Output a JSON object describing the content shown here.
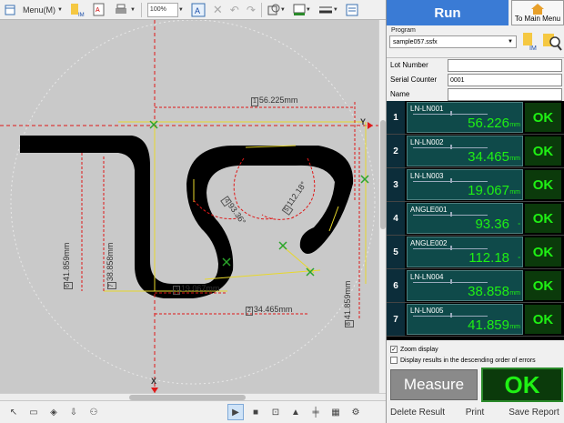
{
  "toolbar": {
    "menu_label": "Menu(M)",
    "zoom_value": "100%"
  },
  "canvas": {
    "dimensions": [
      {
        "box": "1",
        "text": "56.225mm"
      },
      {
        "box": "3",
        "text": "19.067mm"
      },
      {
        "box": "2",
        "text": "34.465mm"
      },
      {
        "box": "4",
        "text": "93.36°"
      },
      {
        "box": "5",
        "text": "112.18°"
      },
      {
        "box": "6",
        "text": "41.859mm"
      },
      {
        "box": "7",
        "text": "38.858mm"
      },
      {
        "box": "8",
        "text": "41.859mm"
      }
    ],
    "axis_y_label": "Y",
    "axis_x_label": "X"
  },
  "panel": {
    "run_title": "Run",
    "main_menu_label": "To Main Menu",
    "program_label": "Program",
    "program_value": "sample057.ssfx",
    "fields": [
      {
        "label": "Lot Number",
        "value": ""
      },
      {
        "label": "Serial Counter",
        "value": "0001"
      },
      {
        "label": "Name",
        "value": ""
      }
    ],
    "results": [
      {
        "num": "1",
        "name": "LN-LN001",
        "value": "56.226",
        "unit": "mm",
        "judge": "OK"
      },
      {
        "num": "2",
        "name": "LN-LN002",
        "value": "34.465",
        "unit": "mm",
        "judge": "OK"
      },
      {
        "num": "3",
        "name": "LN-LN003",
        "value": "19.067",
        "unit": "mm",
        "judge": "OK"
      },
      {
        "num": "4",
        "name": "ANGLE001",
        "value": "93.36",
        "unit": "°",
        "judge": "OK"
      },
      {
        "num": "5",
        "name": "ANGLE002",
        "value": "112.18",
        "unit": "°",
        "judge": "OK"
      },
      {
        "num": "6",
        "name": "LN-LN004",
        "value": "38.858",
        "unit": "mm",
        "judge": "OK"
      },
      {
        "num": "7",
        "name": "LN-LN005",
        "value": "41.859",
        "unit": "mm",
        "judge": "OK"
      }
    ],
    "zoom_display_label": "Zoom display",
    "zoom_display_checked": true,
    "descending_label": "Display results in the descending order of errors",
    "descending_checked": false,
    "measure_label": "Measure",
    "total_judge": "OK",
    "delete_label": "Delete Result",
    "print_label": "Print",
    "save_label": "Save Report"
  }
}
